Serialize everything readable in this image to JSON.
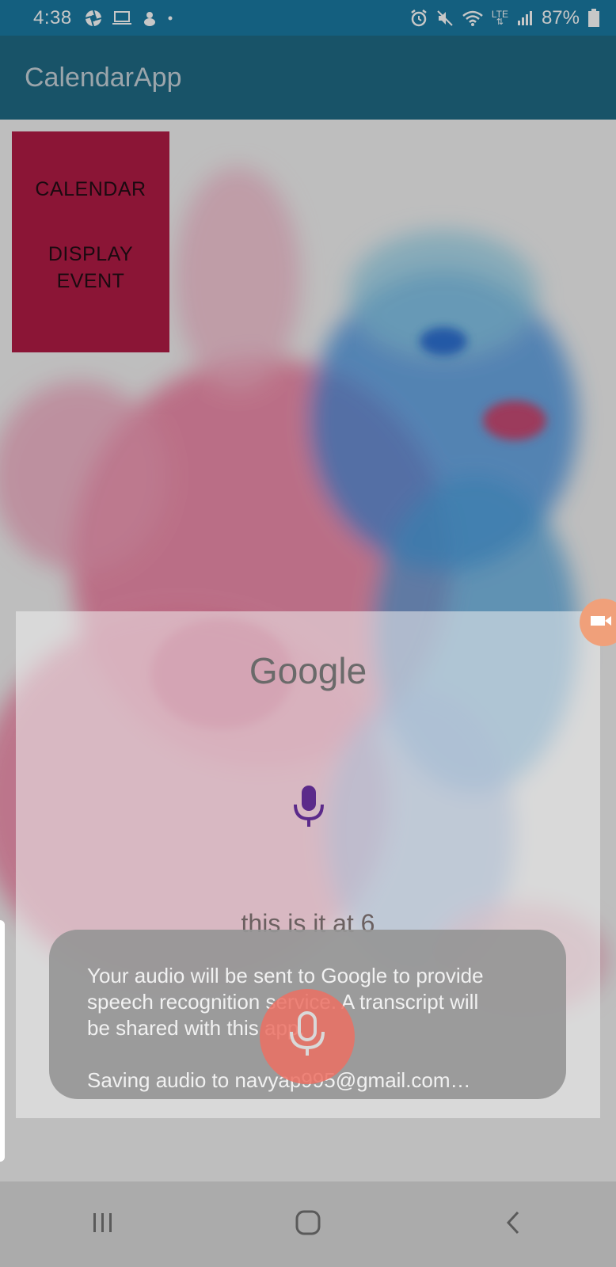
{
  "status_bar": {
    "time": "4:38",
    "left_icons": [
      "aperture-icon",
      "laptop-icon",
      "spider-icon",
      "dot-icon"
    ],
    "right_icons": [
      "alarm-icon",
      "mute-icon",
      "wifi-icon",
      "lte-icon",
      "signal-icon",
      "battery-icon"
    ],
    "lte_label": "LTE",
    "battery_percent": "87%"
  },
  "app_bar": {
    "title": "CalendarApp"
  },
  "buttons": {
    "calendar_label": "CALENDAR",
    "display_event_line1": "DISPLAY",
    "display_event_line2": "EVENT"
  },
  "voice_dialog": {
    "logo_text": "Google",
    "transcript": "this is it at 6"
  },
  "toast": {
    "line1": "Your audio will be sent to Google to provide",
    "line2": "speech recognition service. A transcript will",
    "line3": "be shared with this app.",
    "saving": "Saving audio to navyap995@gmail.com…"
  },
  "nav_bar": {
    "items": [
      "recent-apps-icon",
      "home-icon",
      "back-icon"
    ]
  },
  "colors": {
    "status_bar": "#1a7aa3",
    "app_bar": "#1f6b86",
    "button_panel": "#8b1536",
    "mic": "#5b2a8a",
    "record_button": "#ec7063"
  }
}
